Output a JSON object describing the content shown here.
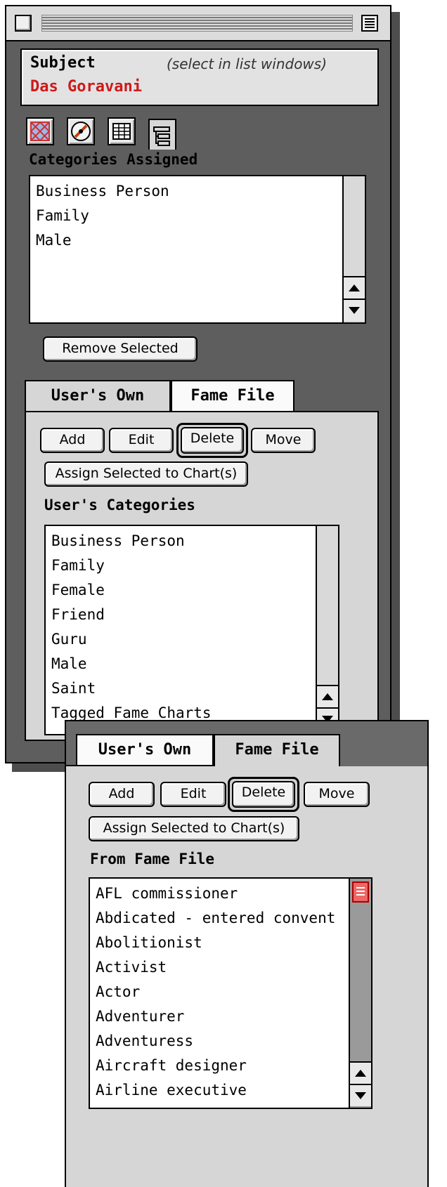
{
  "subject": {
    "label": "Subject",
    "hint": "(select in list windows)",
    "name": "Das Goravani"
  },
  "toolbar": {
    "icons": [
      "grid-wheel-icon",
      "compass-icon",
      "table-icon",
      "category-tree-icon"
    ]
  },
  "assigned": {
    "title": "Categories Assigned",
    "items": [
      "Business Person",
      "Family",
      "Male"
    ],
    "remove_label": "Remove Selected"
  },
  "tabs": {
    "users_own": "User's Own",
    "fame_file": "Fame File"
  },
  "buttons": {
    "add": "Add",
    "edit": "Edit",
    "delete": "Delete",
    "move": "Move",
    "assign": "Assign Selected to Chart(s)"
  },
  "user_categories": {
    "title": "User's Categories",
    "items": [
      "Business Person",
      "Family",
      "Female",
      "Friend",
      "Guru",
      "Male",
      "Saint",
      "Tagged Fame Charts"
    ]
  },
  "fame_categories": {
    "title": "From Fame File",
    "items": [
      "AFL commissioner",
      "Abdicated - entered convent",
      "Abolitionist",
      "Activist",
      "Actor",
      "Adventurer",
      "Adventuress",
      "Aircraft designer",
      "Airline executive"
    ]
  },
  "colors": {
    "subject_name": "#cc1a1a",
    "window_bg": "#5e5e5e",
    "panel_bg": "#d6d6d6"
  }
}
